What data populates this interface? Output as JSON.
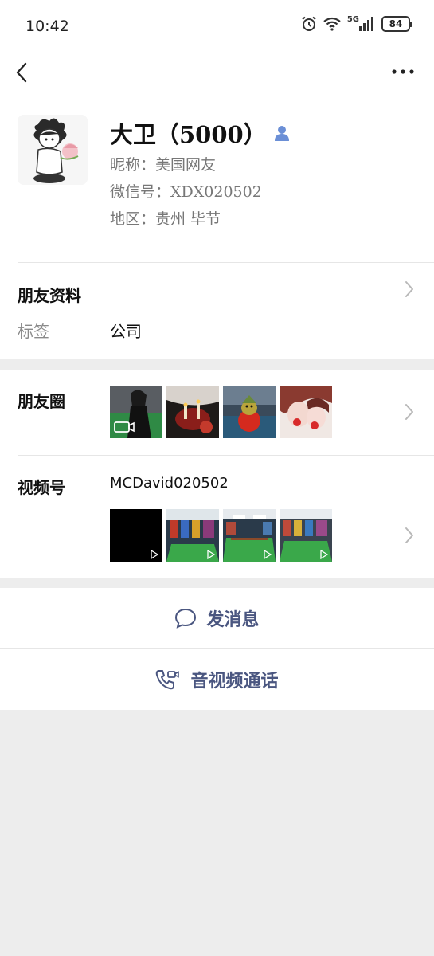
{
  "status_bar": {
    "time": "10:42",
    "network": "5G",
    "battery": "84",
    "icons": [
      "alarm-icon",
      "wifi-icon",
      "signal-icon",
      "battery-icon"
    ]
  },
  "nav": {
    "back_icon": "chevron-left-icon",
    "more_icon": "more-icon"
  },
  "profile": {
    "name": "大卫（5000）",
    "nickname": "昵称：美国网友",
    "wechat_id": "微信号：XDX020502",
    "region": "地区：贵州 毕节"
  },
  "friend_info": {
    "title": "朋友资料",
    "tag_label": "标签",
    "tag_value": "公司"
  },
  "moments": {
    "title": "朋友圈"
  },
  "channels": {
    "title": "视频号",
    "account": "MCDavid020502"
  },
  "actions": {
    "message": "发消息",
    "call": "音视频通话"
  },
  "colors": {
    "accent": "#4a5680",
    "background": "#ededed",
    "snooker_green": "#3aa84a",
    "badge_blue": "#6b8fd6"
  }
}
